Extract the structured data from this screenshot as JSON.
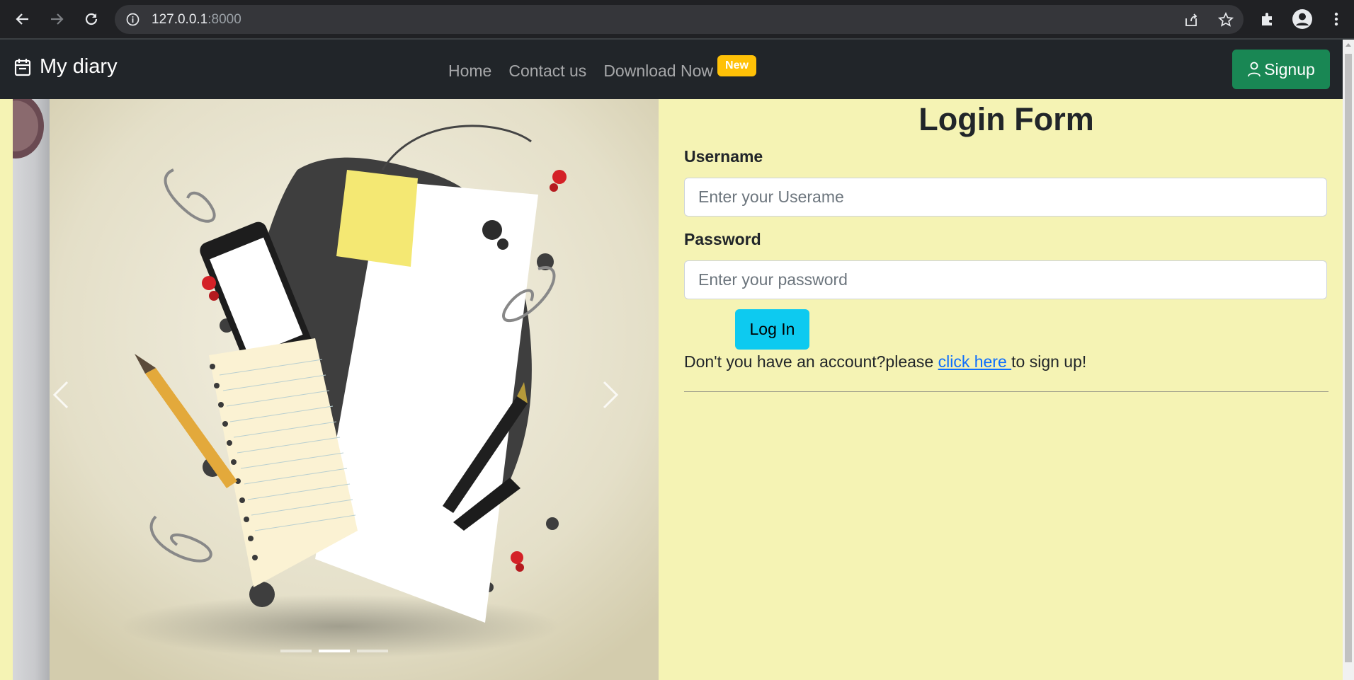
{
  "browser": {
    "url_host": "127.0.0.1",
    "url_port": ":8000"
  },
  "navbar": {
    "brand": "My diary",
    "links": [
      "Home",
      "Contact us",
      "Download Now"
    ],
    "badge": "New",
    "signup_label": "Signup"
  },
  "carousel": {
    "slide_count": 3,
    "active_index": 1
  },
  "login": {
    "title": "Login Form",
    "username_label": "Username",
    "username_placeholder": "Enter your Userame",
    "password_label": "Password",
    "password_placeholder": "Enter your password",
    "submit_label": "Log In",
    "prompt_before": "Don't you have an account?please ",
    "link_text": "click here ",
    "prompt_after": "to sign up!"
  },
  "colors": {
    "page_background": "#f5f3b4",
    "navbar": "#212529",
    "signup_button": "#198754",
    "login_button": "#0dcaf0",
    "badge": "#ffc107",
    "link": "#0d6efd"
  }
}
